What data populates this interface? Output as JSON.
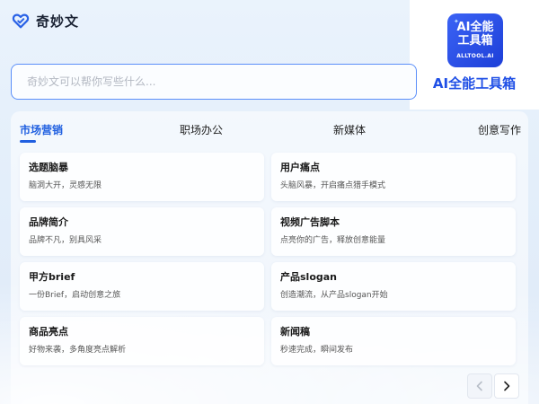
{
  "header": {
    "app_name": "奇妙文"
  },
  "badge": {
    "line1": "AI全能",
    "line2": "工具箱",
    "small": "ALLTOOL.AI",
    "caption": "AI全能工具箱"
  },
  "search": {
    "placeholder": "奇妙文可以帮你写些什么..."
  },
  "tabs": [
    {
      "label": "市场营销",
      "active": true
    },
    {
      "label": "职场办公"
    },
    {
      "label": "新媒体"
    },
    {
      "label": "创意写作"
    }
  ],
  "cards": [
    {
      "title": "选题脑暴",
      "desc": "脑洞大开，灵感无限"
    },
    {
      "title": "用户痛点",
      "desc": "头脑风暴，开启痛点猎手模式"
    },
    {
      "title": "品牌简介",
      "desc": "品牌不凡，别具风采"
    },
    {
      "title": "视频广告脚本",
      "desc": "点亮你的广告，释放创意能量"
    },
    {
      "title": "甲方brief",
      "desc": "一份Brief，启动创意之旅"
    },
    {
      "title": "产品slogan",
      "desc": "创造潮流，从产品slogan开始"
    },
    {
      "title": "商品亮点",
      "desc": "好物来袭，多角度亮点解析"
    },
    {
      "title": "新闻稿",
      "desc": "秒速完成，瞬间发布"
    }
  ],
  "colors": {
    "accent": "#1f5fe0",
    "search_border": "#5b8ff9",
    "badge_blue": "#2a4fe8"
  },
  "icons": {
    "logo": "heart-link-icon",
    "prev": "chevron-left-icon",
    "next": "chevron-right-icon"
  }
}
